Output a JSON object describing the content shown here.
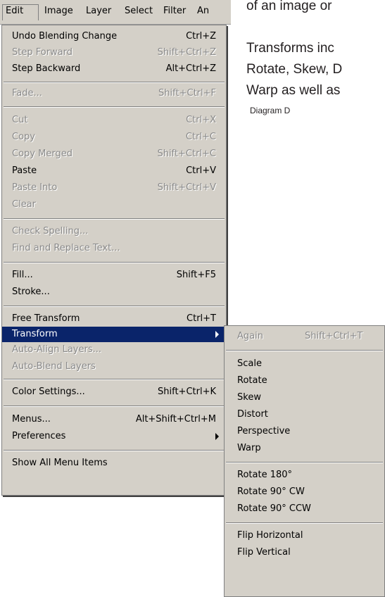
{
  "document": {
    "lines": [
      "of an image or",
      "Transforms inc",
      "Rotate, Skew, D",
      "Warp as well as"
    ],
    "caption": "Diagram D"
  },
  "menubar": {
    "items": [
      "Edit",
      "Image",
      "Layer",
      "Select",
      "Filter",
      "An"
    ]
  },
  "edit_menu": {
    "undo": {
      "label": "Undo Blending Change",
      "shortcut": "Ctrl+Z"
    },
    "step_forward": {
      "label": "Step Forward",
      "shortcut": "Shift+Ctrl+Z"
    },
    "step_backward": {
      "label": "Step Backward",
      "shortcut": "Alt+Ctrl+Z"
    },
    "fade": {
      "label": "Fade...",
      "shortcut": "Shift+Ctrl+F"
    },
    "cut": {
      "label": "Cut",
      "shortcut": "Ctrl+X"
    },
    "copy": {
      "label": "Copy",
      "shortcut": "Ctrl+C"
    },
    "copy_merged": {
      "label": "Copy Merged",
      "shortcut": "Shift+Ctrl+C"
    },
    "paste": {
      "label": "Paste",
      "shortcut": "Ctrl+V"
    },
    "paste_into": {
      "label": "Paste Into",
      "shortcut": "Shift+Ctrl+V"
    },
    "clear": {
      "label": "Clear"
    },
    "check_spelling": {
      "label": "Check Spelling..."
    },
    "find_replace": {
      "label": "Find and Replace Text..."
    },
    "fill": {
      "label": "Fill...",
      "shortcut": "Shift+F5"
    },
    "stroke": {
      "label": "Stroke..."
    },
    "free_transform": {
      "label": "Free Transform",
      "shortcut": "Ctrl+T"
    },
    "transform": {
      "label": "Transform"
    },
    "auto_align": {
      "label": "Auto-Align Layers..."
    },
    "auto_blend": {
      "label": "Auto-Blend Layers"
    },
    "color_settings": {
      "label": "Color Settings...",
      "shortcut": "Shift+Ctrl+K"
    },
    "menus": {
      "label": "Menus...",
      "shortcut": "Alt+Shift+Ctrl+M"
    },
    "preferences": {
      "label": "Preferences"
    },
    "show_all": {
      "label": "Show All Menu Items"
    }
  },
  "transform_menu": {
    "again": {
      "label": "Again",
      "shortcut": "Shift+Ctrl+T"
    },
    "scale": {
      "label": "Scale"
    },
    "rotate": {
      "label": "Rotate"
    },
    "skew": {
      "label": "Skew"
    },
    "distort": {
      "label": "Distort"
    },
    "perspective": {
      "label": "Perspective"
    },
    "warp": {
      "label": "Warp"
    },
    "rotate180": {
      "label": "Rotate 180°"
    },
    "rotate90cw": {
      "label": "Rotate 90° CW"
    },
    "rotate90ccw": {
      "label": "Rotate 90° CCW"
    },
    "flip_h": {
      "label": "Flip Horizontal"
    },
    "flip_v": {
      "label": "Flip Vertical"
    }
  },
  "colors": {
    "menu_bg": "#d4d0c8",
    "highlight": "#0a246a",
    "disabled_text": "#8a8a8a"
  }
}
